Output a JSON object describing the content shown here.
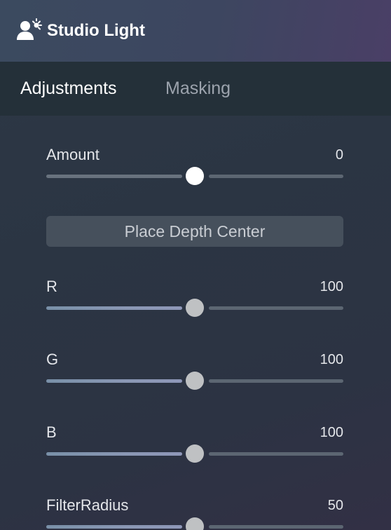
{
  "panel": {
    "title": "Studio Light",
    "icon": "person-light-icon"
  },
  "tabs": [
    {
      "label": "Adjustments",
      "active": true
    },
    {
      "label": "Masking",
      "active": false
    }
  ],
  "controls": {
    "amount": {
      "label": "Amount",
      "value": "0"
    },
    "r": {
      "label": "R",
      "value": "100"
    },
    "g": {
      "label": "G",
      "value": "100"
    },
    "b": {
      "label": "B",
      "value": "100"
    },
    "filter_radius": {
      "label": "FilterRadius",
      "value": "50"
    }
  },
  "place_depth_button": "Place Depth Center"
}
